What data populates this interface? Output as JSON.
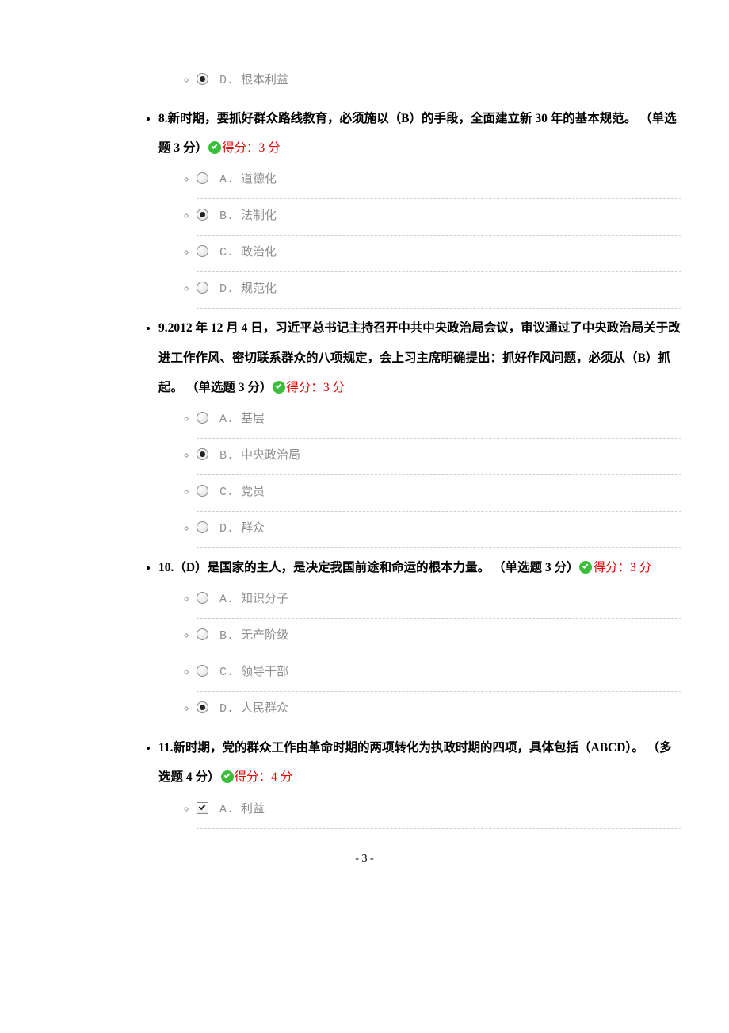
{
  "questions": [
    {
      "num": "",
      "text": "",
      "type": "",
      "score_prefix": "",
      "score_text": "",
      "tail_only": true,
      "options": [
        {
          "letter": "D",
          "text": "根本利益",
          "selected": true,
          "kind": "radio",
          "no_border": true
        }
      ]
    },
    {
      "num": "8",
      "text": "新时期，要抓好群众路线教育，必须施以（B）的手段，全面建立新 30 年的基本规范。",
      "type": "（单选题 3 分）",
      "score_prefix": "得分：",
      "score_text": "3 分",
      "options": [
        {
          "letter": "A",
          "text": "道德化",
          "selected": false,
          "kind": "radio"
        },
        {
          "letter": "B",
          "text": "法制化",
          "selected": true,
          "kind": "radio"
        },
        {
          "letter": "C",
          "text": "政治化",
          "selected": false,
          "kind": "radio"
        },
        {
          "letter": "D",
          "text": "规范化",
          "selected": false,
          "kind": "radio"
        }
      ]
    },
    {
      "num": "9",
      "text": "2012 年 12 月 4 日，习近平总书记主持召开中共中央政治局会议，审议通过了中央政治局关于改进工作作风、密切联系群众的八项规定，会上习主席明确提出：抓好作风问题，必须从（B）抓起。",
      "type": "（单选题 3 分）",
      "score_prefix": "得分：",
      "score_text": "3 分",
      "options": [
        {
          "letter": "A",
          "text": "基层",
          "selected": false,
          "kind": "radio"
        },
        {
          "letter": "B",
          "text": "中央政治局",
          "selected": true,
          "kind": "radio"
        },
        {
          "letter": "C",
          "text": "党员",
          "selected": false,
          "kind": "radio"
        },
        {
          "letter": "D",
          "text": "群众",
          "selected": false,
          "kind": "radio"
        }
      ]
    },
    {
      "num": "10",
      "text": "（D）是国家的主人，是决定我国前途和命运的根本力量。",
      "type": "（单选题 3 分）",
      "score_prefix": "得分：",
      "score_text": "3 分",
      "options": [
        {
          "letter": "A",
          "text": "知识分子",
          "selected": false,
          "kind": "radio"
        },
        {
          "letter": "B",
          "text": "无产阶级",
          "selected": false,
          "kind": "radio"
        },
        {
          "letter": "C",
          "text": "领导干部",
          "selected": false,
          "kind": "radio"
        },
        {
          "letter": "D",
          "text": "人民群众",
          "selected": true,
          "kind": "radio"
        }
      ]
    },
    {
      "num": "11",
      "text": "新时期，党的群众工作由革命时期的两项转化为执政时期的四项，具体包括（ABCD）。",
      "type": "（多选题 4 分）",
      "score_prefix": "得分：",
      "score_text": "4 分",
      "options": [
        {
          "letter": "A",
          "text": "利益",
          "selected": true,
          "kind": "checkbox"
        }
      ]
    }
  ],
  "page_number": "- 3 -"
}
